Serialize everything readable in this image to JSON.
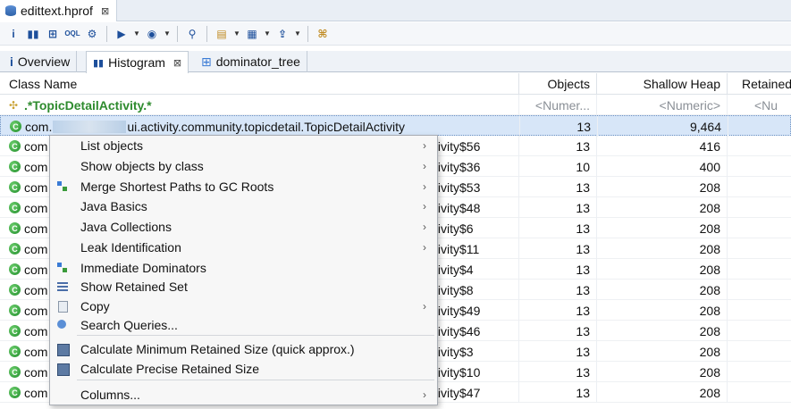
{
  "editor": {
    "tab_title": "edittext.hprof"
  },
  "view_tabs": [
    {
      "label": "Overview"
    },
    {
      "label": "Histogram"
    },
    {
      "label": "dominator_tree"
    }
  ],
  "table": {
    "headers": {
      "class_name": "Class Name",
      "objects": "Objects",
      "shallow_heap": "Shallow Heap",
      "retained": "Retained"
    },
    "filter": {
      "class_name": ".*TopicDetailActivity.*",
      "objects": "<Numer...",
      "shallow_heap": "<Numeric>",
      "retained": "<Nu"
    },
    "rows": [
      {
        "prefix": "com.",
        "suffix": "ui.activity.community.topicdetail.TopicDetailActivity",
        "objects": "13",
        "shallow": "9,464"
      },
      {
        "prefix": "com",
        "suffix": "tivity$56",
        "objects": "13",
        "shallow": "416"
      },
      {
        "prefix": "com",
        "suffix": "tivity$36",
        "objects": "10",
        "shallow": "400"
      },
      {
        "prefix": "com",
        "suffix": "tivity$53",
        "objects": "13",
        "shallow": "208"
      },
      {
        "prefix": "com",
        "suffix": "tivity$48",
        "objects": "13",
        "shallow": "208"
      },
      {
        "prefix": "com",
        "suffix": "tivity$6",
        "objects": "13",
        "shallow": "208"
      },
      {
        "prefix": "com",
        "suffix": "tivity$11",
        "objects": "13",
        "shallow": "208"
      },
      {
        "prefix": "com",
        "suffix": "tivity$4",
        "objects": "13",
        "shallow": "208"
      },
      {
        "prefix": "com",
        "suffix": "tivity$8",
        "objects": "13",
        "shallow": "208"
      },
      {
        "prefix": "com",
        "suffix": "tivity$49",
        "objects": "13",
        "shallow": "208"
      },
      {
        "prefix": "com",
        "suffix": "tivity$46",
        "objects": "13",
        "shallow": "208"
      },
      {
        "prefix": "com",
        "suffix": "tivity$3",
        "objects": "13",
        "shallow": "208"
      },
      {
        "prefix": "com",
        "suffix": "tivity$10",
        "objects": "13",
        "shallow": "208"
      },
      {
        "prefix": "com",
        "suffix": "tivity$47",
        "objects": "13",
        "shallow": "208"
      }
    ]
  },
  "context_menu": {
    "items": [
      {
        "label": "List objects",
        "submenu": true,
        "icon": "none"
      },
      {
        "label": "Show objects by class",
        "submenu": true,
        "icon": "none"
      },
      {
        "label": "Merge Shortest Paths to GC Roots",
        "submenu": true,
        "icon": "tree-icon"
      },
      {
        "label": "Java Basics",
        "submenu": true,
        "icon": "none"
      },
      {
        "label": "Java Collections",
        "submenu": true,
        "icon": "none"
      },
      {
        "label": "Leak Identification",
        "submenu": true,
        "icon": "none"
      },
      {
        "label": "Immediate Dominators",
        "submenu": false,
        "icon": "tree-icon"
      },
      {
        "label": "Show Retained Set",
        "submenu": false,
        "icon": "lines-icon"
      },
      {
        "label": "Copy",
        "submenu": true,
        "icon": "copy-icon"
      },
      {
        "label": "Search Queries...",
        "submenu": false,
        "icon": "search-icon"
      },
      {
        "label": "Calculate Minimum Retained Size (quick approx.)",
        "submenu": false,
        "icon": "calculator-icon"
      },
      {
        "label": "Calculate Precise Retained Size",
        "submenu": false,
        "icon": "calculator-icon"
      },
      {
        "label": "Columns...",
        "submenu": true,
        "icon": "none"
      }
    ]
  }
}
